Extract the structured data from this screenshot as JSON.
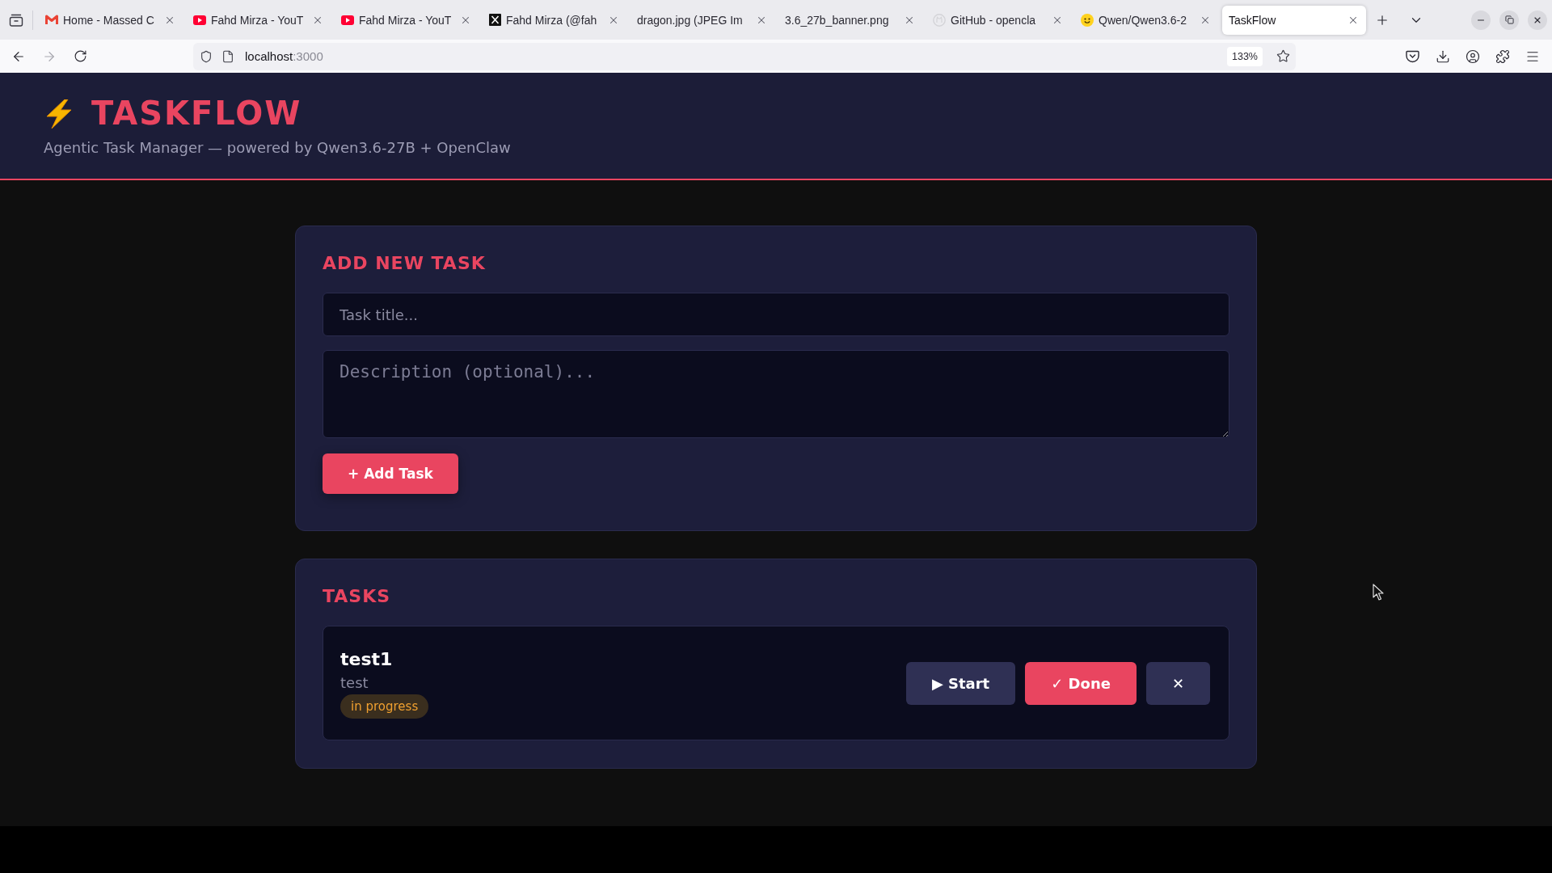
{
  "browser": {
    "tabs": [
      {
        "kind": "mail",
        "title": "Home - Massed C",
        "selected": false
      },
      {
        "kind": "video",
        "title": "Fahd Mirza - YouT",
        "selected": false
      },
      {
        "kind": "video",
        "title": "Fahd Mirza - YouT",
        "selected": false
      },
      {
        "kind": "social",
        "title": "Fahd Mirza (@fah",
        "selected": false
      },
      {
        "kind": "plain",
        "title": "dragon.jpg (JPEG Im",
        "selected": false
      },
      {
        "kind": "plain",
        "title": "3.6_27b_banner.png",
        "selected": false
      },
      {
        "kind": "repo",
        "title": "GitHub - opencla",
        "selected": false
      },
      {
        "kind": "model",
        "title": "Qwen/Qwen3.6-2",
        "selected": false
      },
      {
        "kind": "plain",
        "title": "TaskFlow",
        "selected": true
      }
    ],
    "address": {
      "host": "localhost",
      "port": ":3000"
    },
    "zoom": "133%"
  },
  "header": {
    "title": "TASKFLOW",
    "subtitle": "Agentic Task Manager — powered by Qwen3.6-27B + OpenClaw"
  },
  "add_task": {
    "heading": "ADD NEW TASK",
    "title_field": {
      "placeholder": "Task title..."
    },
    "description_field": {
      "placeholder": "Description (optional)..."
    },
    "button": "+ Add Task"
  },
  "tasks": {
    "heading": "TASKS",
    "items": [
      {
        "title": "test1",
        "description": "test",
        "status": "in progress",
        "actions": [
          {
            "kind": "secondary",
            "label": "▶ Start"
          },
          {
            "kind": "primary",
            "label": "✓ Done"
          },
          {
            "kind": "secondary",
            "label": "✕"
          }
        ]
      }
    ]
  }
}
